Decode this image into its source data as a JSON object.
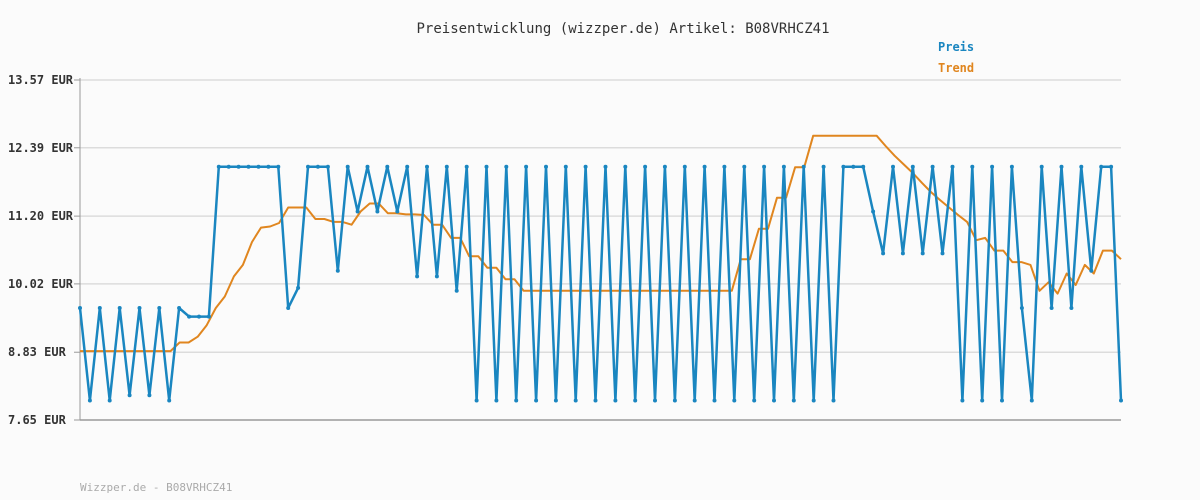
{
  "chart_data": {
    "type": "line",
    "title": "Preisentwicklung (wizzper.de) Artikel: B08VRHCZ41",
    "footer": "Wizzper.de - B08VRHCZ41",
    "ylim": [
      7.65,
      13.57
    ],
    "yticks": [
      13.57,
      12.39,
      11.2,
      10.02,
      8.83,
      7.65
    ],
    "ytick_labels": [
      "13.57 EUR",
      "12.39 EUR",
      "11.20 EUR",
      "10.02 EUR",
      "8.83 EUR",
      "7.65 EUR"
    ],
    "grid": true,
    "legend_position": "top-right",
    "colors": {
      "preis": "#1a86c0",
      "trend": "#e0861f",
      "grid": "#dcdcdc",
      "axis": "#999999"
    },
    "series": [
      {
        "name": "Preis",
        "color": "#1a86c0",
        "markers": true,
        "values": [
          9.6,
          7.99,
          9.6,
          7.99,
          9.6,
          8.08,
          9.6,
          8.08,
          9.6,
          7.99,
          9.6,
          9.45,
          9.45,
          9.45,
          12.06,
          12.06,
          12.06,
          12.06,
          12.06,
          12.06,
          12.06,
          9.6,
          9.95,
          12.06,
          12.06,
          12.06,
          10.25,
          12.06,
          11.28,
          12.06,
          11.28,
          12.06,
          11.28,
          12.06,
          10.15,
          12.06,
          10.15,
          12.06,
          9.9,
          12.06,
          7.99,
          12.06,
          7.99,
          12.06,
          7.99,
          12.06,
          7.99,
          12.06,
          7.99,
          12.06,
          7.99,
          12.06,
          7.99,
          12.06,
          7.99,
          12.06,
          7.99,
          12.06,
          7.99,
          12.06,
          7.99,
          12.06,
          7.99,
          12.06,
          7.99,
          12.06,
          7.99,
          12.06,
          7.99,
          12.06,
          7.99,
          12.06,
          7.99,
          12.06,
          7.99,
          12.06,
          7.99,
          12.06,
          12.06,
          12.06,
          11.28,
          10.55,
          12.06,
          10.55,
          12.06,
          10.55,
          12.06,
          10.55,
          12.06,
          7.99,
          12.06,
          7.99,
          12.06,
          7.99,
          12.06,
          9.6,
          7.99,
          12.06,
          9.6,
          12.06,
          9.6,
          12.06,
          10.25,
          12.06,
          12.06,
          7.99
        ],
        "segments": [
          {
            "from": 0,
            "to": 13,
            "values": [
              9.6,
              7.99,
              9.6,
              7.99,
              9.6,
              8.08,
              9.6,
              8.08,
              9.6,
              7.99,
              9.6,
              9.45,
              9.45,
              9.45
            ]
          },
          {
            "from": 14,
            "to": 24,
            "values": [
              12.06,
              12.06,
              12.06,
              12.06,
              12.06,
              12.06,
              12.06,
              9.6,
              9.95,
              12.06,
              12.06
            ]
          },
          {
            "from": 25,
            "to": 39,
            "values": [
              12.06,
              10.25,
              12.06,
              11.28,
              12.06,
              11.28,
              12.06,
              11.28,
              12.06,
              10.15,
              12.06,
              10.15,
              12.06,
              9.9,
              12.06
            ]
          },
          {
            "from": 40,
            "to": 62,
            "values": [
              7.99,
              12.06,
              7.99,
              12.06,
              7.99,
              12.06,
              7.99,
              12.06,
              7.99,
              12.06,
              7.99,
              12.06,
              7.99,
              12.06,
              7.99,
              12.06,
              7.99,
              12.06,
              7.99,
              12.06,
              7.99,
              12.06,
              7.99
            ]
          },
          {
            "from": 63,
            "to": 77,
            "values": [
              12.06,
              7.99,
              12.06,
              7.99,
              12.06,
              7.99,
              12.06,
              7.99,
              12.06,
              7.99,
              12.06,
              7.99,
              12.06,
              7.99,
              12.06
            ]
          },
          {
            "from": 64,
            "to": 77,
            "x_from": 63.0,
            "pattern": "zigzag"
          }
        ]
      },
      {
        "name": "Trend",
        "color": "#e0861f",
        "markers": false,
        "values": [
          8.85,
          8.85,
          8.85,
          8.85,
          8.85,
          8.85,
          8.85,
          8.85,
          8.85,
          8.85,
          8.85,
          9.0,
          9.0,
          9.1,
          9.3,
          9.6,
          9.8,
          10.15,
          10.35,
          10.75,
          11.0,
          11.02,
          11.08,
          11.35,
          11.35,
          11.35,
          11.15,
          11.15,
          11.1,
          11.1,
          11.05,
          11.28,
          11.42,
          11.42,
          11.25,
          11.25,
          11.23,
          11.23,
          11.22,
          11.05,
          11.05,
          10.82,
          10.82,
          10.5,
          10.5,
          10.3,
          10.3,
          10.1,
          10.1,
          9.9,
          9.9,
          9.9,
          9.9,
          9.9,
          9.9,
          9.9,
          9.9,
          9.9,
          9.9,
          9.9,
          9.9,
          9.9,
          9.9,
          9.9,
          9.9,
          9.9,
          9.9,
          9.9,
          9.9,
          9.9,
          9.9,
          9.9,
          9.9,
          10.45,
          10.45,
          10.98,
          10.98,
          11.52,
          11.52,
          12.05,
          12.05,
          12.6,
          12.6,
          12.6,
          12.6,
          12.6,
          12.6,
          12.6,
          12.6,
          12.42,
          12.25,
          12.1,
          11.95,
          11.78,
          11.62,
          11.48,
          11.35,
          11.22,
          11.1,
          10.78,
          10.82,
          10.6,
          10.6,
          10.4,
          10.4,
          10.35,
          9.9,
          10.05,
          9.85,
          10.2,
          10.0,
          10.35,
          10.2,
          10.6,
          10.6,
          10.45
        ]
      }
    ]
  }
}
